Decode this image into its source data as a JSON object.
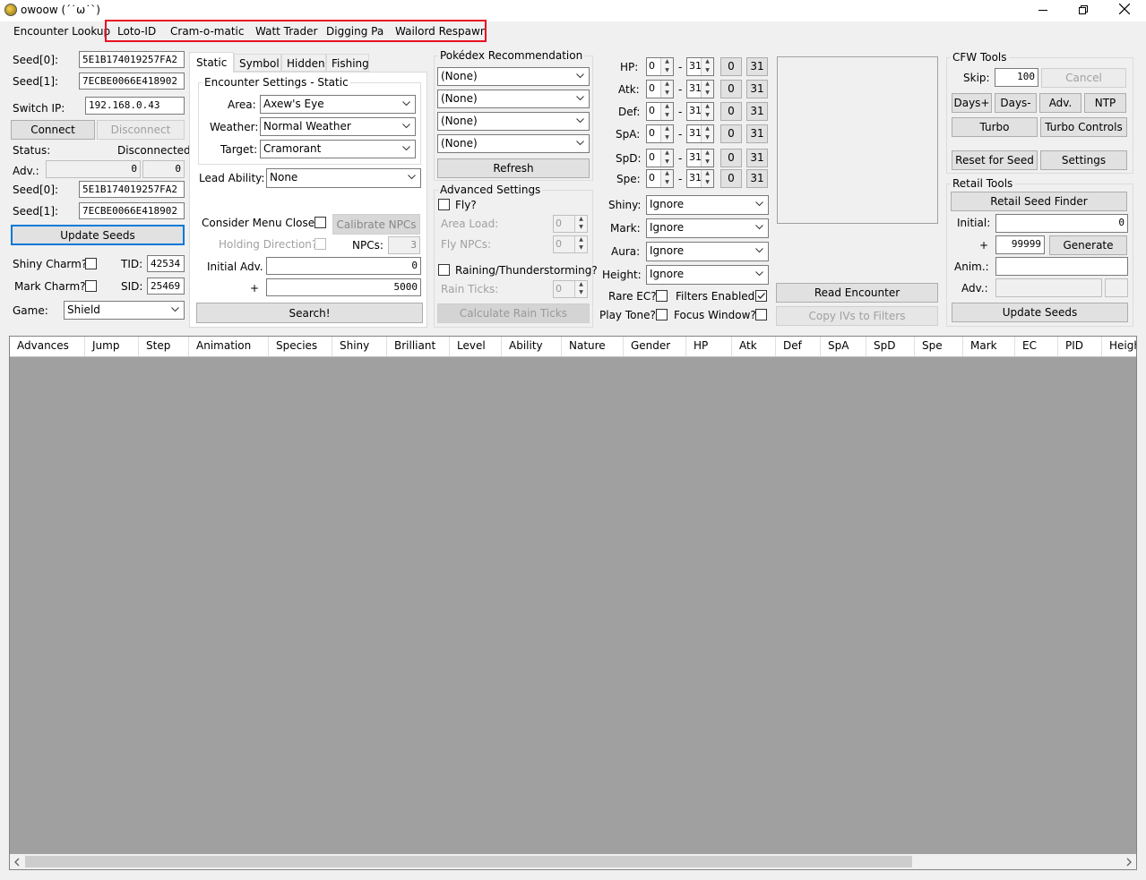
{
  "window": {
    "title": "owoow (ˊ˙ω˙ˋ)"
  },
  "menu": {
    "items": [
      "Encounter Lookup",
      "Loto-ID",
      "Cram-o-matic",
      "Watt Trader",
      "Digging Pa",
      "Wailord Respawn"
    ]
  },
  "connection": {
    "seed0_label": "Seed[0]:",
    "seed0": "5E1B174019257FA2",
    "seed1_label": "Seed[1]:",
    "seed1": "7ECBE0066E418902",
    "switch_ip_label": "Switch IP:",
    "switch_ip": "192.168.0.43",
    "connect": "Connect",
    "disconnect": "Disconnect",
    "status_label": "Status:",
    "status": "Disconnected!",
    "adv_label": "Adv.:",
    "adv1": "0",
    "adv2": "0",
    "cur_seed0_label": "Seed[0]:",
    "cur_seed0": "5E1B174019257FA2",
    "cur_seed1_label": "Seed[1]:",
    "cur_seed1": "7ECBE0066E418902",
    "update_seeds": "Update Seeds",
    "shiny_charm": "Shiny Charm?",
    "mark_charm": "Mark Charm?",
    "tid_label": "TID:",
    "tid": "42534",
    "sid_label": "SID:",
    "sid": "25469",
    "game_label": "Game:",
    "game": "Shield"
  },
  "encounter": {
    "tabs": [
      "Static",
      "Symbol",
      "Hidden",
      "Fishing"
    ],
    "group_title": "Encounter Settings - Static",
    "area_label": "Area:",
    "area": "Axew's Eye",
    "weather_label": "Weather:",
    "weather": "Normal Weather",
    "target_label": "Target:",
    "target": "Cramorant",
    "lead_label": "Lead Ability:",
    "lead": "None",
    "menu_close": "Consider Menu Close?",
    "calibrate": "Calibrate NPCs",
    "holding": "Holding Direction?",
    "npcs_label": "NPCs:",
    "npcs": "3",
    "initial_label": "Initial Adv.",
    "initial": "0",
    "plus": "+",
    "range": "5000",
    "search": "Search!"
  },
  "pokedex": {
    "title": "Pokédex Recommendation",
    "options": [
      "(None)",
      "(None)",
      "(None)",
      "(None)"
    ],
    "refresh": "Refresh"
  },
  "advanced": {
    "title": "Advanced Settings",
    "fly": "Fly?",
    "area_load_label": "Area Load:",
    "area_load": "0",
    "fly_npcs_label": "Fly NPCs:",
    "fly_npcs": "0",
    "raining": "Raining/Thunderstorming?",
    "rain_label": "Rain Ticks:",
    "rain": "0",
    "calc_rain": "Calculate Rain Ticks"
  },
  "filters": {
    "ivs": [
      {
        "label": "HP:",
        "min": "0",
        "max": "31",
        "b0": "0",
        "b31": "31"
      },
      {
        "label": "Atk:",
        "min": "0",
        "max": "31",
        "b0": "0",
        "b31": "31"
      },
      {
        "label": "Def:",
        "min": "0",
        "max": "31",
        "b0": "0",
        "b31": "31"
      },
      {
        "label": "SpA:",
        "min": "0",
        "max": "31",
        "b0": "0",
        "b31": "31"
      },
      {
        "label": "SpD:",
        "min": "0",
        "max": "31",
        "b0": "0",
        "b31": "31"
      },
      {
        "label": "Spe:",
        "min": "0",
        "max": "31",
        "b0": "0",
        "b31": "31"
      }
    ],
    "dash": "-",
    "shiny_label": "Shiny:",
    "shiny": "Ignore",
    "mark_label": "Mark:",
    "mark": "Ignore",
    "aura_label": "Aura:",
    "aura": "Ignore",
    "height_label": "Height:",
    "height": "Ignore",
    "rare_ec": "Rare EC?",
    "filters_enabled": "Filters Enabled?",
    "play_tone": "Play Tone?",
    "focus_window": "Focus Window?"
  },
  "preview": {
    "read": "Read Encounter",
    "copy": "Copy IVs to Filters"
  },
  "cfw": {
    "title": "CFW Tools",
    "skip_label": "Skip:",
    "skip": "100",
    "cancel": "Cancel",
    "days_plus": "Days+",
    "days_minus": "Days-",
    "adv": "Adv.",
    "ntp": "NTP",
    "turbo": "Turbo",
    "turbo_controls": "Turbo Controls",
    "reset": "Reset for Seed",
    "settings": "Settings"
  },
  "retail": {
    "title": "Retail Tools",
    "finder": "Retail Seed Finder",
    "initial_label": "Initial:",
    "initial": "0",
    "plus": "+",
    "range": "99999",
    "generate": "Generate",
    "anim_label": "Anim.:",
    "adv_label": "Adv.:",
    "update": "Update Seeds"
  },
  "results": {
    "columns": [
      "Advances",
      "Jump",
      "Step",
      "Animation",
      "Species",
      "Shiny",
      "Brilliant",
      "Level",
      "Ability",
      "Nature",
      "Gender",
      "HP",
      "Atk",
      "Def",
      "SpA",
      "SpD",
      "Spe",
      "Mark",
      "EC",
      "PID",
      "Height"
    ]
  },
  "colors": {
    "highlight": "#e81123",
    "focus": "#0078d7",
    "grid_bg": "#a0a0a0"
  }
}
